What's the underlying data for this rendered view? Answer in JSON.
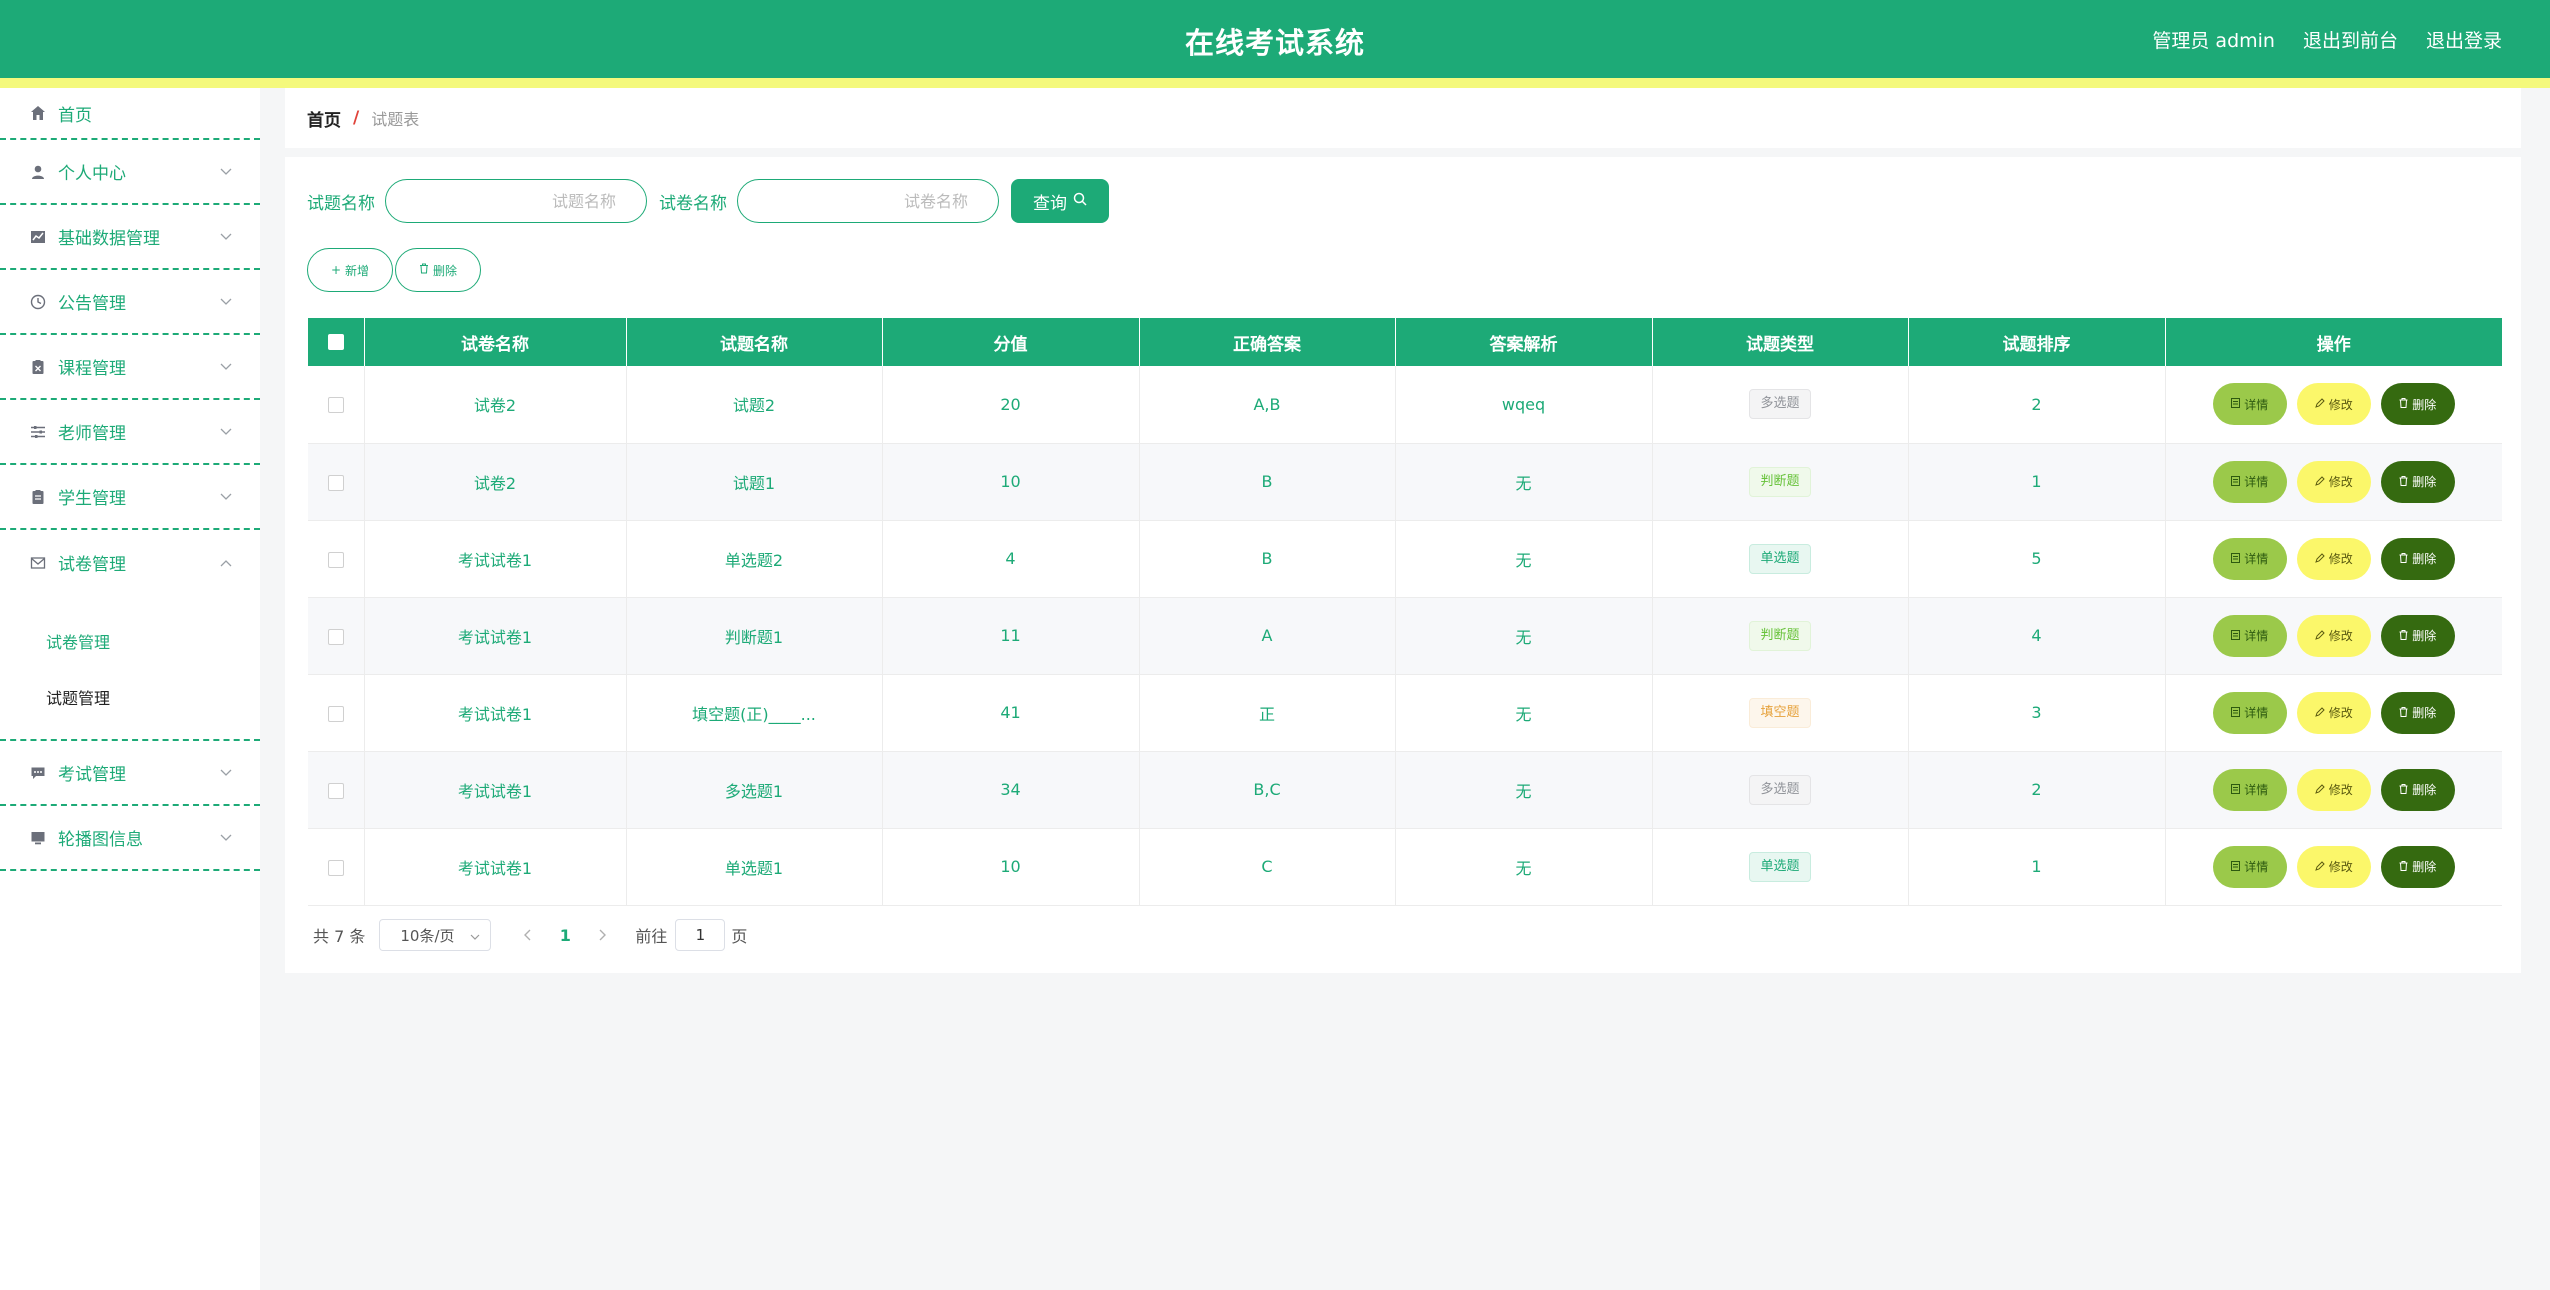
{
  "header": {
    "title": "在线考试系统",
    "user_label": "管理员 admin",
    "front_link": "退出到前台",
    "logout_link": "退出登录"
  },
  "sidebar": {
    "home": "首页",
    "items": [
      {
        "label": "个人中心",
        "icon": "user-icon"
      },
      {
        "label": "基础数据管理",
        "icon": "chart-icon"
      },
      {
        "label": "公告管理",
        "icon": "clock-icon"
      },
      {
        "label": "课程管理",
        "icon": "clipboard-x-icon"
      },
      {
        "label": "老师管理",
        "icon": "sliders-icon"
      },
      {
        "label": "学生管理",
        "icon": "clipboard-icon"
      },
      {
        "label": "试卷管理",
        "icon": "mail-icon",
        "open": true
      },
      {
        "label": "考试管理",
        "icon": "chat-icon"
      },
      {
        "label": "轮播图信息",
        "icon": "monitor-icon"
      }
    ],
    "sub_items": [
      "试卷管理",
      "试题管理"
    ]
  },
  "breadcrumb": {
    "home": "首页",
    "separator": "/",
    "current": "试题表"
  },
  "search": {
    "question_label": "试题名称",
    "question_placeholder": "试题名称",
    "paper_label": "试卷名称",
    "paper_placeholder": "试卷名称",
    "query_button": "查询"
  },
  "actions": {
    "add": "新增",
    "delete": "删除"
  },
  "table": {
    "headers": [
      "试卷名称",
      "试题名称",
      "分值",
      "正确答案",
      "答案解析",
      "试题类型",
      "试题排序",
      "操作"
    ],
    "rows": [
      {
        "paper": "试卷2",
        "question": "试题2",
        "score": "20",
        "answer": "A,B",
        "analysis": "wqeq",
        "type": "多选题",
        "order": "2"
      },
      {
        "paper": "试卷2",
        "question": "试题1",
        "score": "10",
        "answer": "B",
        "analysis": "无",
        "type": "判断题",
        "order": "1"
      },
      {
        "paper": "考试试卷1",
        "question": "单选题2",
        "score": "4",
        "answer": "B",
        "analysis": "无",
        "type": "单选题",
        "order": "5"
      },
      {
        "paper": "考试试卷1",
        "question": "判断题1",
        "score": "11",
        "answer": "A",
        "analysis": "无",
        "type": "判断题",
        "order": "4"
      },
      {
        "paper": "考试试卷1",
        "question": "填空题(正)____...",
        "score": "41",
        "answer": "正",
        "analysis": "无",
        "type": "填空题",
        "order": "3"
      },
      {
        "paper": "考试试卷1",
        "question": "多选题1",
        "score": "34",
        "answer": "B,C",
        "analysis": "无",
        "type": "多选题",
        "order": "2"
      },
      {
        "paper": "考试试卷1",
        "question": "单选题1",
        "score": "10",
        "answer": "C",
        "analysis": "无",
        "type": "单选题",
        "order": "1"
      }
    ],
    "op_labels": {
      "detail": "详情",
      "edit": "修改",
      "delete": "删除"
    }
  },
  "pagination": {
    "total": "共 7 条",
    "page_size": "10条/页",
    "current_page": "1",
    "goto_label": "前往",
    "goto_value": "1",
    "goto_suffix": "页"
  },
  "colors": {
    "primary": "#1daa77",
    "stripe": "#f4f97c",
    "detail_btn": "#9bc94a",
    "edit_btn": "#fbf76a",
    "delete_btn": "#356a10"
  }
}
